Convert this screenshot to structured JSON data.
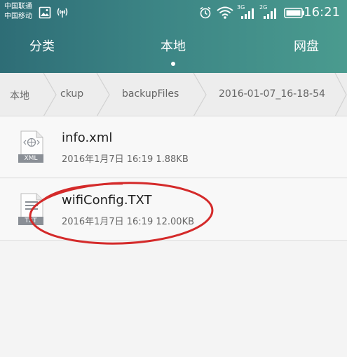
{
  "status_bar": {
    "carrier_1": "中国联通",
    "carrier_2": "中国移动",
    "network_1": "3G",
    "network_2": "2G",
    "time": "16:21",
    "icons": [
      "image-icon",
      "hotspot-icon",
      "alarm-icon",
      "wifi-icon",
      "signal-icon",
      "battery-icon"
    ]
  },
  "tabs": [
    {
      "label": "分类"
    },
    {
      "label": "本地"
    },
    {
      "label": "网盘"
    }
  ],
  "breadcrumb": [
    {
      "label": "本地"
    },
    {
      "label": "ckup"
    },
    {
      "label": "backupFiles"
    },
    {
      "label": "2016-01-07_16-18-54"
    }
  ],
  "files": [
    {
      "name": "info.xml",
      "meta": "2016年1月7日 16:19 1.88KB",
      "type_label": "XML",
      "icon": "xml-file-icon"
    },
    {
      "name": "wifiConfig.TXT",
      "meta": "2016年1月7日 16:19 12.00KB",
      "type_label": "TXT",
      "icon": "txt-file-icon"
    }
  ],
  "colors": {
    "header_start": "#2e6d76",
    "header_end": "#4a9b8f",
    "annotation": "#d42a2a"
  }
}
